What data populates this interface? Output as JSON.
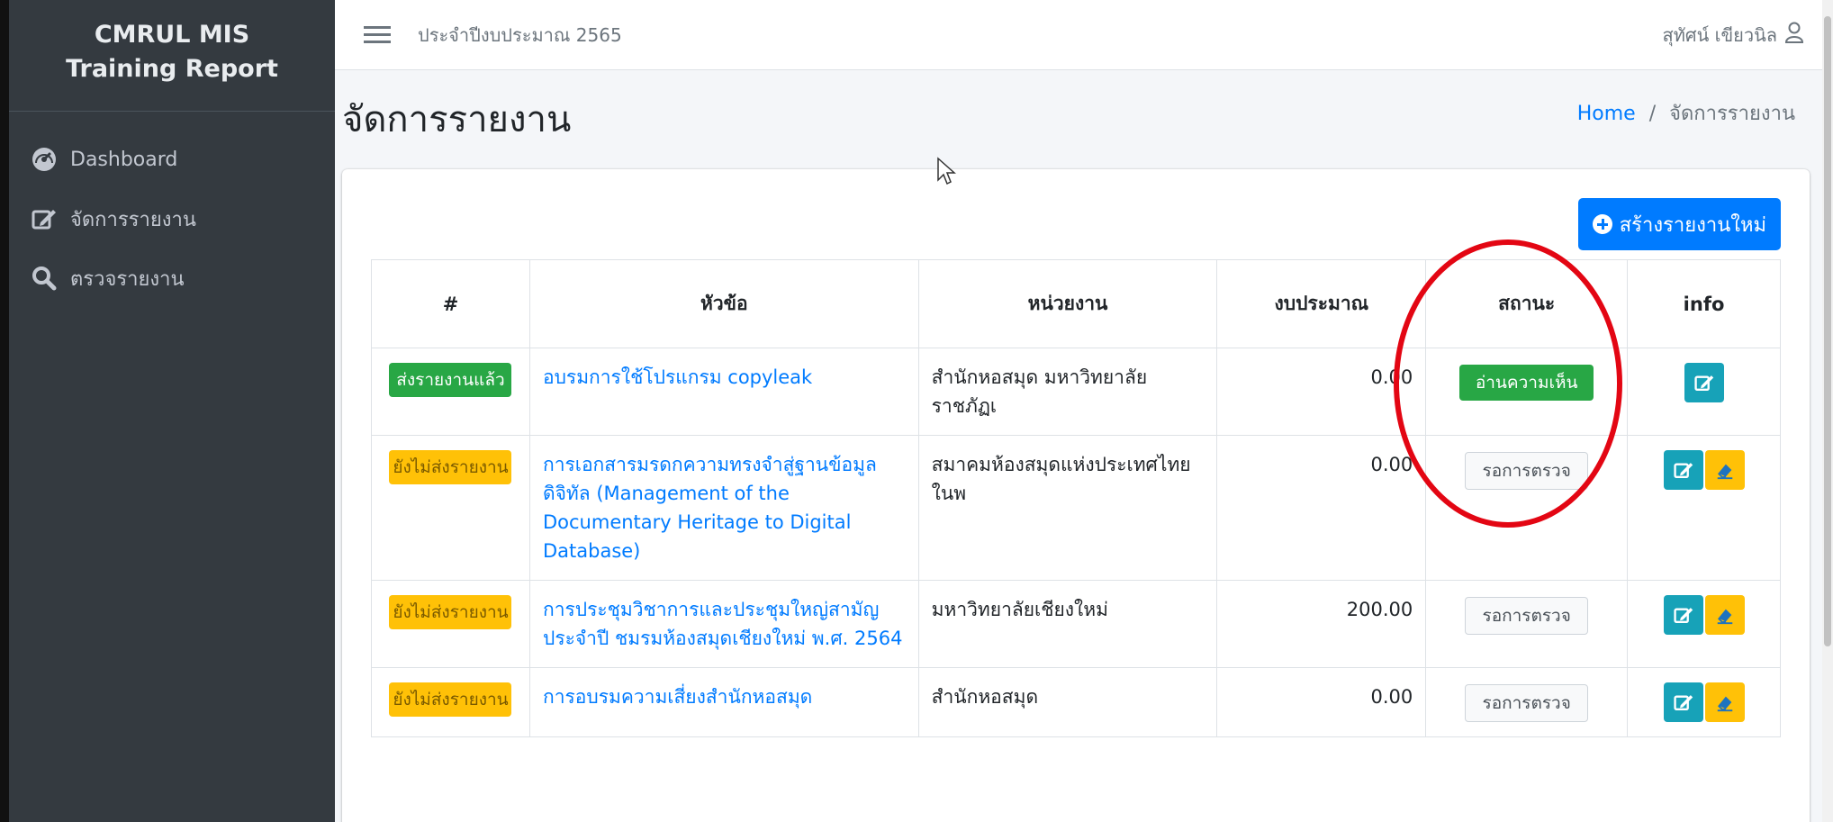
{
  "sidebar": {
    "brand_line1": "CMRUL MIS",
    "brand_line2": "Training Report",
    "items": [
      {
        "label": "Dashboard",
        "icon": "tachometer-icon"
      },
      {
        "label": "จัดการรายงาน",
        "icon": "edit-icon"
      },
      {
        "label": "ตรวจรายงาน",
        "icon": "search-icon"
      }
    ]
  },
  "topbar": {
    "fiscal_year": "ประจำปีงบประมาณ 2565",
    "user_name": "สุทัศน์ เขียวนิล"
  },
  "page": {
    "title": "จัดการรายงาน",
    "breadcrumb_home": "Home",
    "breadcrumb_sep": "/",
    "breadcrumb_current": "จัดการรายงาน"
  },
  "actions": {
    "new_report": "สร้างรายงานใหม่"
  },
  "table": {
    "headers": [
      "#",
      "หัวข้อ",
      "หน่วยงาน",
      "งบประมาณ",
      "สถานะ",
      "info"
    ],
    "rows": [
      {
        "state": "ส่งรายงานแล้ว",
        "state_color": "#28a745",
        "topic": "อบรมการใช้โปรแกรม copyleak",
        "unit": "สำนักหอสมุด มหาวิทยาลัยราชภัฏเ",
        "budget": "0.00",
        "status": "อ่านความเห็น",
        "status_color": "#28a745"
      },
      {
        "state": "ยังไม่ส่งรายงาน",
        "state_color": "#ffc107",
        "topic": "การเอกสารมรดกความทรงจำสู่ฐานข้อมูลดิจิทัล (Management of the Documentary Heritage to Digital Database)",
        "unit": "สมาคมห้องสมุดแห่งประเทศไทย ในพ",
        "budget": "0.00",
        "status": "รอการตรวจ"
      },
      {
        "state": "ยังไม่ส่งรายงาน",
        "state_color": "#ffc107",
        "topic": "การประชุมวิชาการและประชุมใหญ่สามัญประจำปี ชมรมห้องสมุดเชียงใหม่ พ.ศ. 2564",
        "unit": "มหาวิทยาลัยเชียงใหม่",
        "budget": "200.00",
        "status": "รอการตรวจ"
      },
      {
        "state": "ยังไม่ส่งรายงาน",
        "state_color": "#ffc107",
        "topic": "การอบรมความเสี่ยงสำนักหอสมุด",
        "unit": "สำนักหอสมุด",
        "budget": "0.00",
        "status": "รอการตรวจ"
      }
    ]
  },
  "colors": {
    "sidebar_bg": "#343a40",
    "primary": "#007bff",
    "success": "#28a745",
    "warning": "#ffc107",
    "info": "#17a2b8",
    "annotation": "#e30613"
  }
}
